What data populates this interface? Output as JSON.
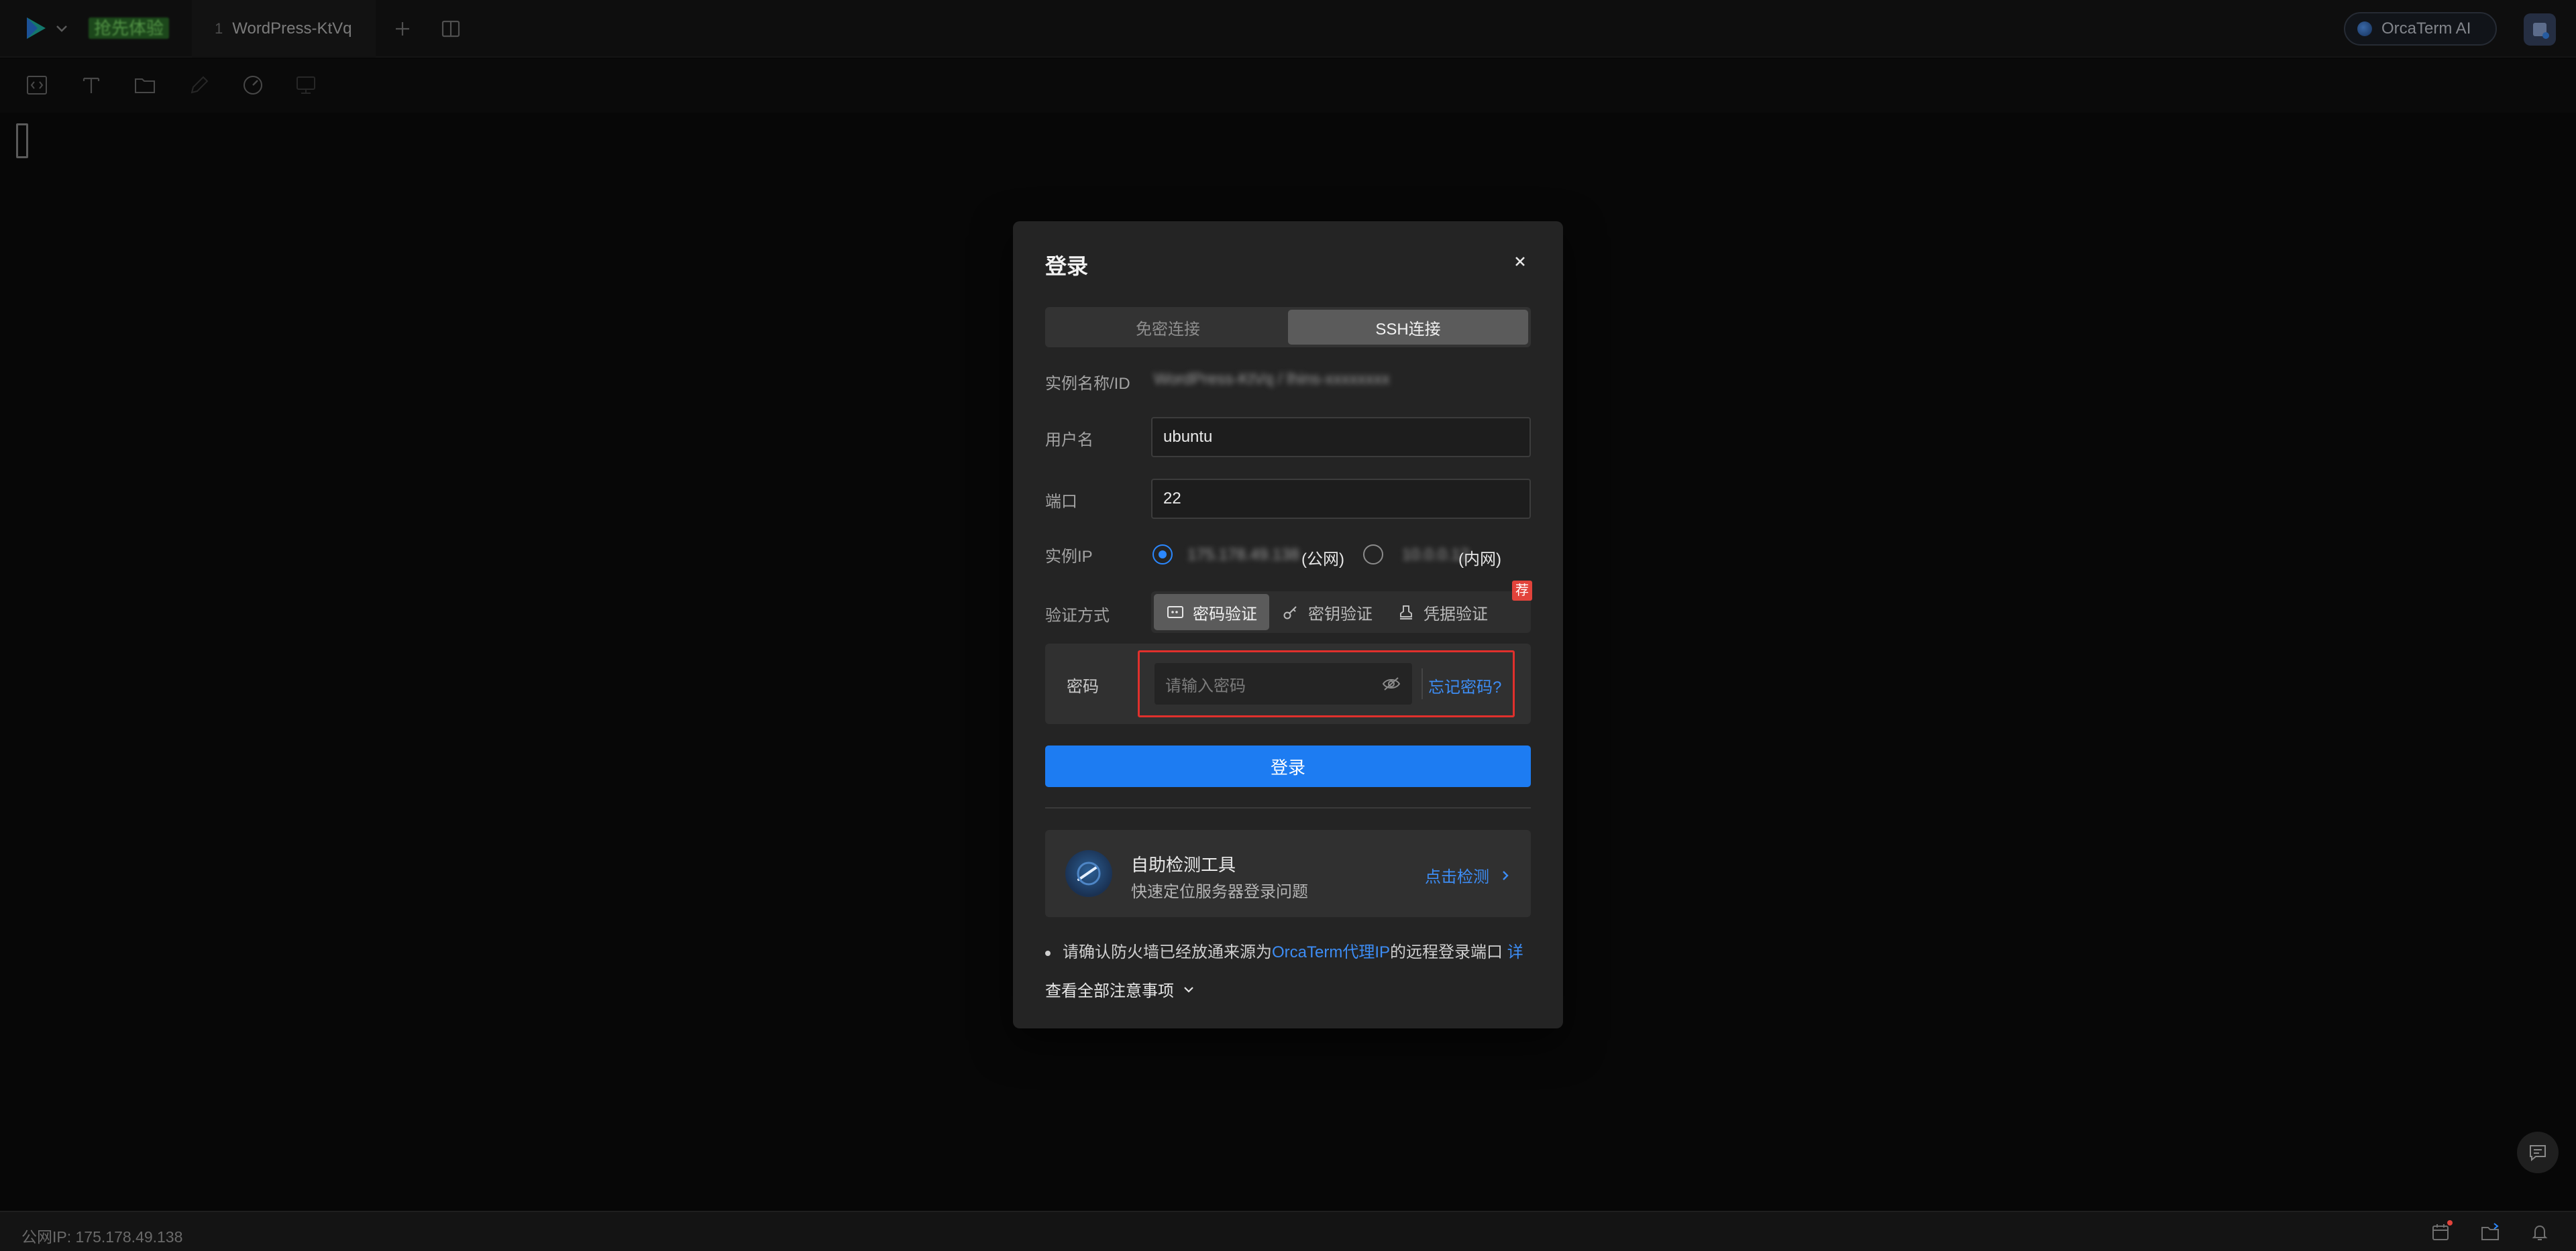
{
  "topbar": {
    "trial_badge": "抢先体验",
    "tab": {
      "index": "1",
      "label": "WordPress-KtVq"
    },
    "orca_ai_label": "OrcaTerm AI"
  },
  "modal": {
    "title": "登录",
    "segments": {
      "passwordless": "免密连接",
      "ssh": "SSH连接",
      "selected": "SSH连接"
    },
    "instance_label": "实例名称/ID",
    "instance_value": "WordPress-KtVq / lhins-xxxxxxxx",
    "username_label": "用户名",
    "username_value": "ubuntu",
    "port_label": "端口",
    "port_value": "22",
    "ip_label": "实例IP",
    "ip_public_value": "175.178.49.138",
    "ip_public_suffix": "(公网)",
    "ip_private_value": "10.0.0.12",
    "ip_private_suffix": "(内网)",
    "auth_label": "验证方式",
    "auth_password": "密码验证",
    "auth_key": "密钥验证",
    "auth_credential": "凭据验证",
    "recommend_badge": "荐",
    "password_label": "密码",
    "password_placeholder": "请输入密码",
    "forgot_password": "忘记密码?",
    "login_button": "登录",
    "tool_card": {
      "title": "自助检测工具",
      "subtitle": "快速定位服务器登录问题",
      "link": "点击检测"
    },
    "notice": {
      "prefix": "请确认防火墙已经放通来源为",
      "link": "OrcaTerm代理IP",
      "suffix": "的远程登录端口",
      "detail": "详"
    },
    "view_all": "查看全部注意事项"
  },
  "statusbar": {
    "public_ip_text": "公网IP: 175.178.49.138"
  },
  "colors": {
    "primary": "#1d7cf2",
    "link": "#3d8df5",
    "highlight_border": "#e0302c",
    "badge": "#e2433b"
  }
}
